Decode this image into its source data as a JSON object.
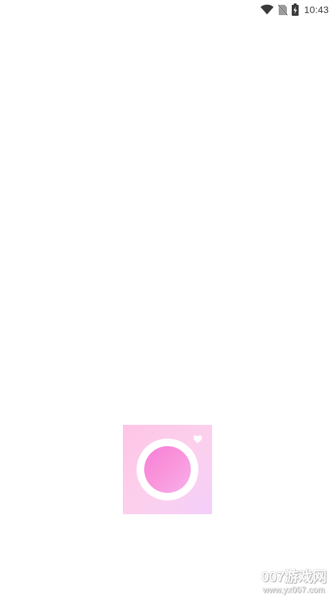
{
  "status_bar": {
    "time": "10:43",
    "icons": [
      "wifi-icon",
      "no-sim-icon",
      "battery-charging-icon"
    ],
    "icon_color": "#3a3a3a"
  },
  "splash": {
    "logo_icon": "camera-lens-heart-icon",
    "colors": {
      "background_start": "#ffc4e6",
      "background_end": "#f4cffb",
      "lens_start": "#f57fdb",
      "lens_end": "#f6b0ec"
    }
  },
  "watermark": {
    "title": "007游戏网",
    "url": "www.yx007.com"
  }
}
